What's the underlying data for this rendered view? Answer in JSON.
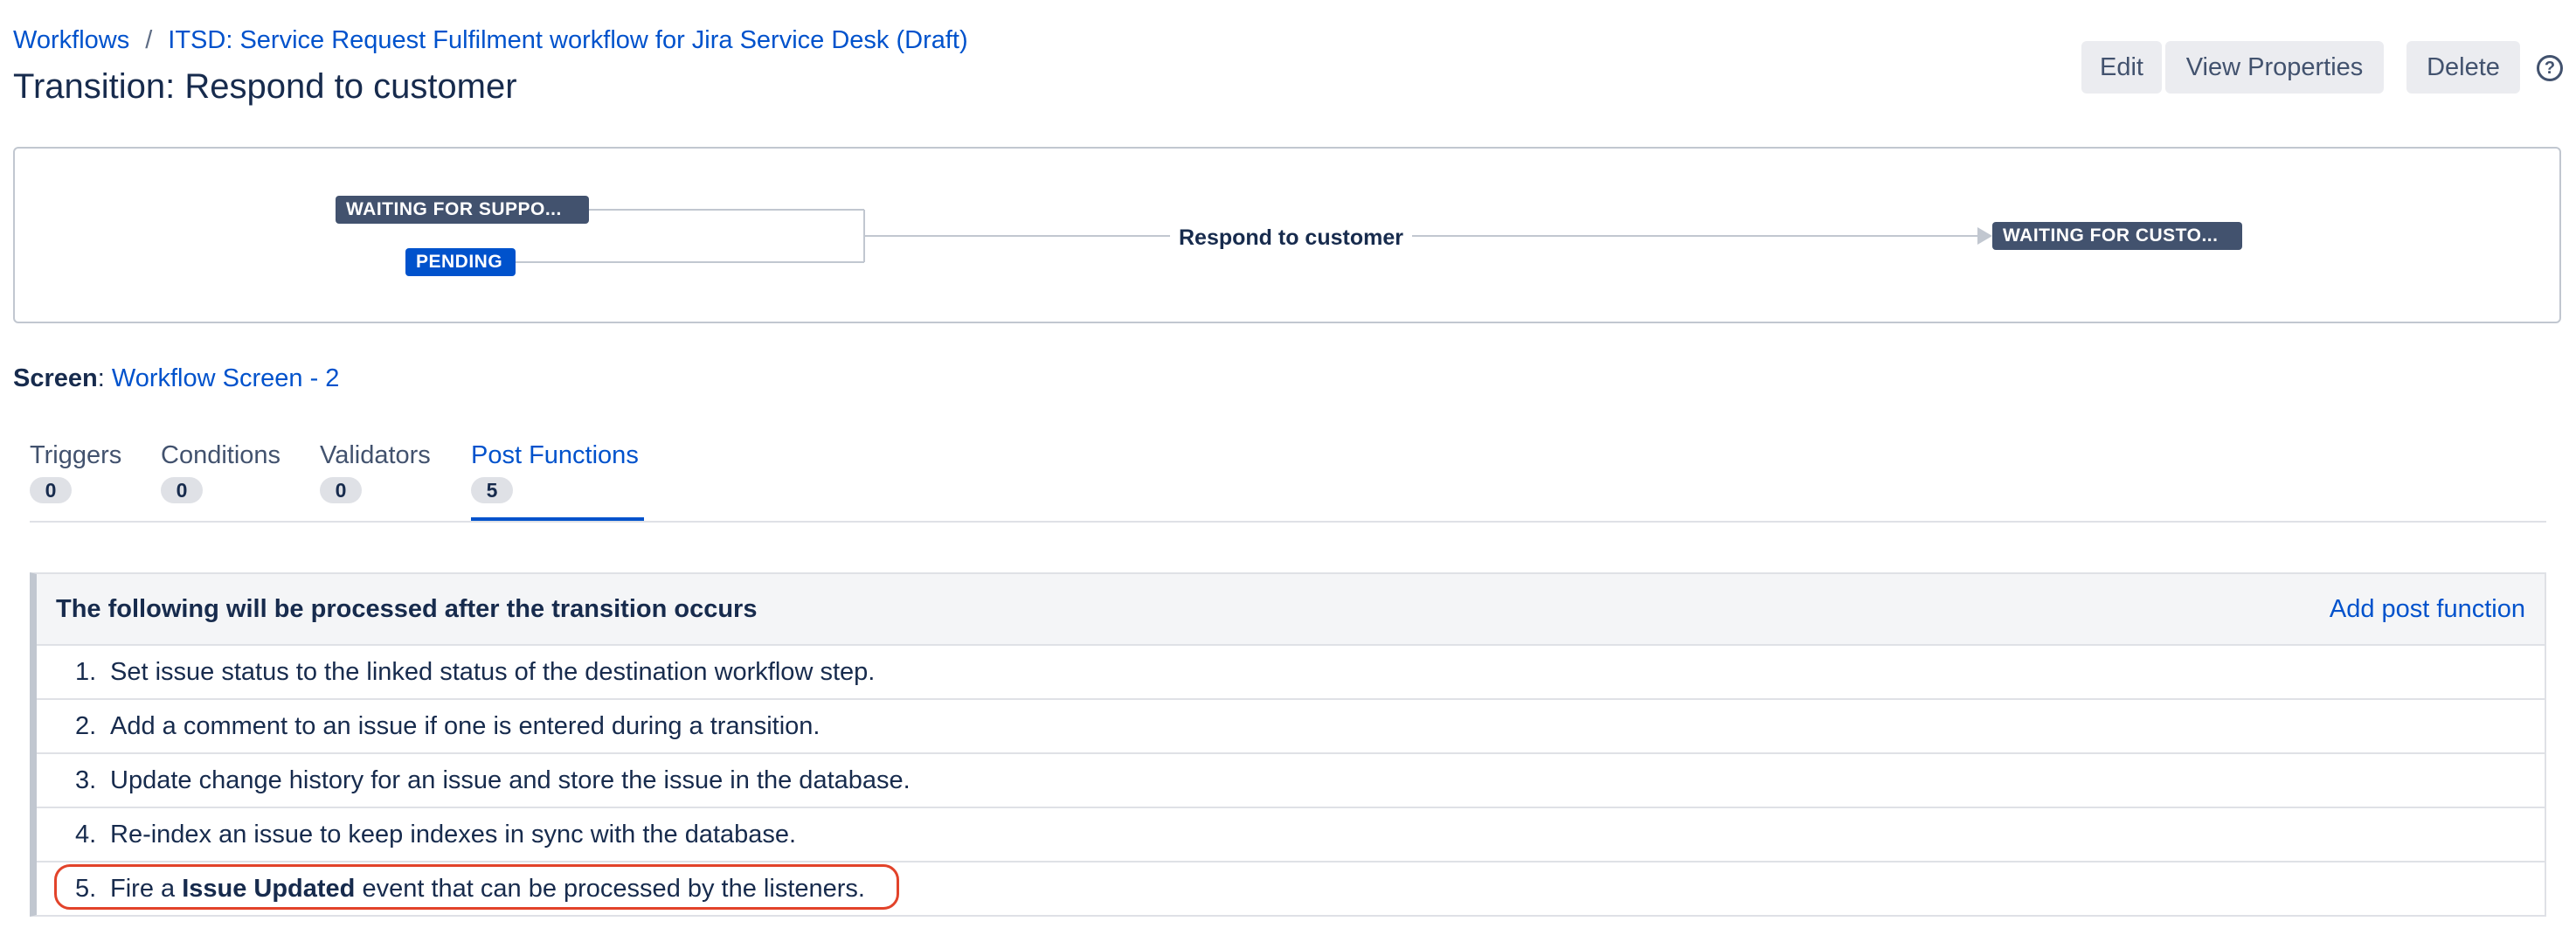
{
  "breadcrumb": {
    "workflows": "Workflows",
    "separator": "/",
    "workflow_name": "ITSD: Service Request Fulfilment workflow for Jira Service Desk (Draft)"
  },
  "page_title": "Transition: Respond to customer",
  "header_buttons": {
    "edit": "Edit",
    "view_properties": "View Properties",
    "delete": "Delete",
    "help": "?"
  },
  "diagram": {
    "source_statuses": [
      "WAITING FOR SUPPO...",
      "PENDING"
    ],
    "transition": "Respond to customer",
    "destination_status": "WAITING FOR CUSTO..."
  },
  "screen": {
    "label": "Screen",
    "colon": ":",
    "value": "Workflow Screen - 2"
  },
  "tabs": [
    {
      "label": "Triggers",
      "count": "0"
    },
    {
      "label": "Conditions",
      "count": "0"
    },
    {
      "label": "Validators",
      "count": "0"
    },
    {
      "label": "Post Functions",
      "count": "5"
    }
  ],
  "active_tab": "Post Functions",
  "post_functions": {
    "header": "The following will be processed after the transition occurs",
    "add_link": "Add post function",
    "items": [
      {
        "num": "1.",
        "text": "Set issue status to the linked status of the destination workflow step."
      },
      {
        "num": "2.",
        "text": "Add a comment to an issue if one is entered during a transition."
      },
      {
        "num": "3.",
        "text": "Update change history for an issue and store the issue in the database."
      },
      {
        "num": "4.",
        "text": "Re-index an issue to keep indexes in sync with the database."
      },
      {
        "num": "5.",
        "prefix": "Fire a ",
        "event": "Issue Updated",
        "suffix": " event that can be processed by the listeners."
      }
    ]
  },
  "colors": {
    "link": "#0052cc",
    "text": "#172b4d",
    "status_dark": "#42526e",
    "status_blue": "#0052cc",
    "highlight": "#e2432a"
  }
}
